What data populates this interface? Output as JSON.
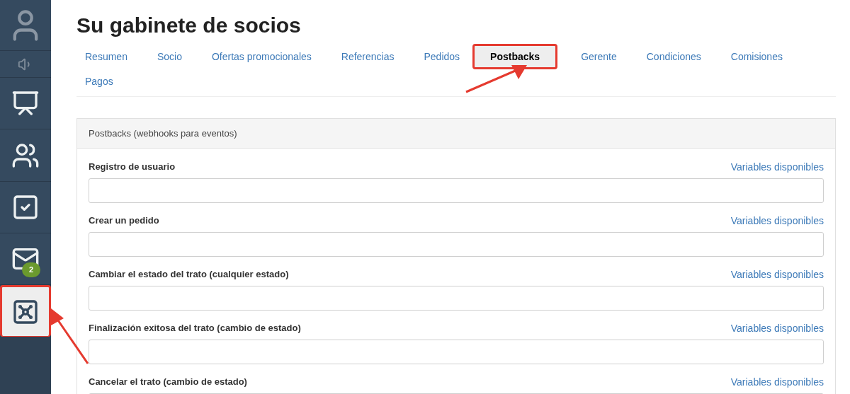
{
  "sidebar": {
    "items": [
      {
        "kind": "avatar",
        "selected": false
      },
      {
        "kind": "sound",
        "selected": false
      },
      {
        "kind": "chart",
        "selected": false
      },
      {
        "kind": "team",
        "selected": false
      },
      {
        "kind": "tasks",
        "selected": false
      },
      {
        "kind": "mail",
        "selected": false,
        "badge": "2"
      },
      {
        "kind": "safe",
        "selected": true
      }
    ]
  },
  "page": {
    "title": "Su gabinete de socios"
  },
  "tabs": [
    {
      "label": "Resumen",
      "selected": false
    },
    {
      "label": "Socio",
      "selected": false
    },
    {
      "label": "Ofertas promocionales",
      "selected": false
    },
    {
      "label": "Referencias",
      "selected": false
    },
    {
      "label": "Pedidos",
      "selected": false
    },
    {
      "label": "Postbacks",
      "selected": true
    },
    {
      "label": "Gerente",
      "selected": false
    },
    {
      "label": "Condiciones",
      "selected": false
    },
    {
      "label": "Comisiones",
      "selected": false
    },
    {
      "label": "Pagos",
      "selected": false
    }
  ],
  "panel": {
    "title": "Postbacks (webhooks para eventos)",
    "fields": [
      {
        "label": "Registro de usuario",
        "link": "Variables disponibles"
      },
      {
        "label": "Crear un pedido",
        "link": "Variables disponibles"
      },
      {
        "label": "Cambiar el estado del trato (cualquier estado)",
        "link": "Variables disponibles"
      },
      {
        "label": "Finalización exitosa del trato (cambio de estado)",
        "link": "Variables disponibles"
      },
      {
        "label": "Cancelar el trato (cambio de estado)",
        "link": "Variables disponibles"
      }
    ]
  }
}
